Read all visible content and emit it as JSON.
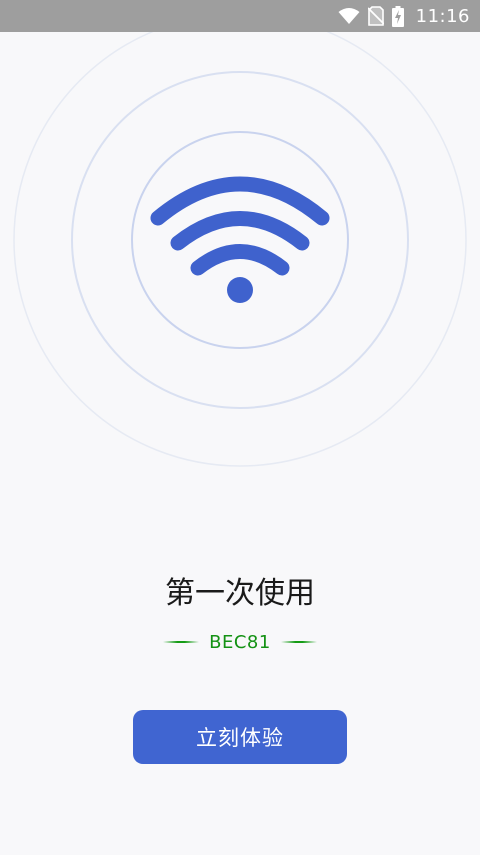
{
  "status_bar": {
    "time": "11:16",
    "icons": [
      "wifi-icon",
      "no-sim-icon",
      "battery-charging-icon"
    ]
  },
  "hero": {
    "icon": "wifi-icon",
    "accent_color": "#3f62cd",
    "ring_color": "#c9d3ee"
  },
  "onboarding": {
    "title": "第一次使用",
    "code": "BEC81",
    "start_button_label": "立刻体验"
  }
}
